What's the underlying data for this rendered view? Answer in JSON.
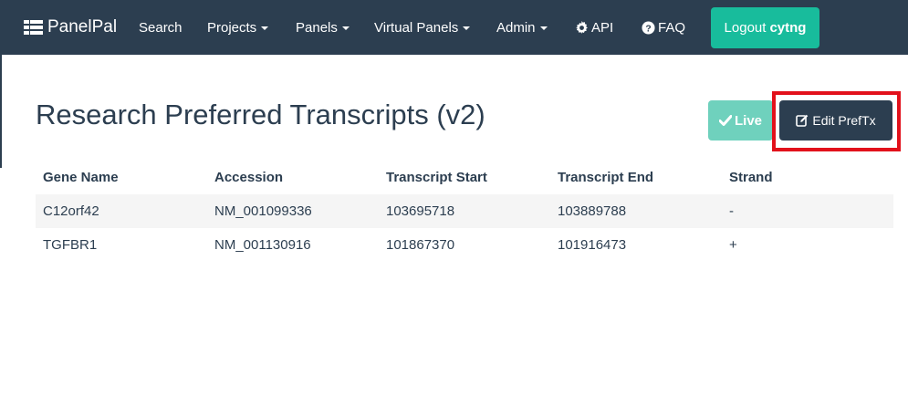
{
  "navbar": {
    "brand": "PanelPal",
    "items": [
      {
        "label": "Search",
        "dropdown": false
      },
      {
        "label": "Projects",
        "dropdown": true
      },
      {
        "label": "Panels",
        "dropdown": true
      },
      {
        "label": "Virtual Panels",
        "dropdown": true
      },
      {
        "label": "Admin",
        "dropdown": true
      },
      {
        "label": "API",
        "icon": "gear-icon"
      },
      {
        "label": "FAQ",
        "icon": "question-circle-icon"
      }
    ],
    "logout_label": "Logout",
    "username": "cytng"
  },
  "page": {
    "title": "Research Preferred Transcripts (v2)",
    "live_label": "Live",
    "edit_label": "Edit PrefTx"
  },
  "table": {
    "headers": [
      "Gene Name",
      "Accession",
      "Transcript Start",
      "Transcript End",
      "Strand"
    ],
    "rows": [
      [
        "C12orf42",
        "NM_001099336",
        "103695718",
        "103889788",
        "-"
      ],
      [
        "TGFBR1",
        "NM_001130916",
        "101867370",
        "101916473",
        "+"
      ]
    ]
  },
  "colors": {
    "navbar": "#2c3e50",
    "accent": "#18bc9c",
    "live_button": "#6fd1bd",
    "highlight": "#e2111b",
    "row_stripe": "#f5f5f5"
  }
}
